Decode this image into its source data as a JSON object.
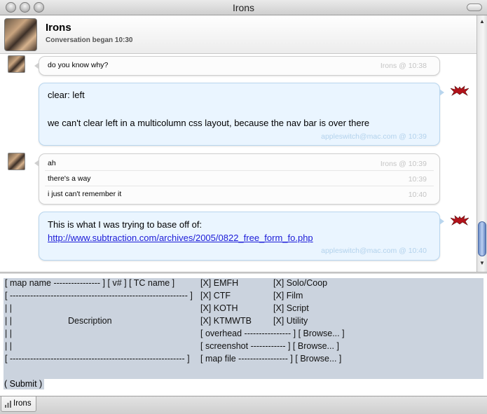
{
  "window": {
    "title": "Irons"
  },
  "header": {
    "name": "Irons",
    "subtitle": "Conversation began 10:30"
  },
  "messages": [
    {
      "lines": [
        {
          "text": "do you know why?",
          "stamp": "Irons @ 10:38"
        }
      ]
    },
    {
      "lines": [
        {
          "text": "clear: left"
        },
        {
          "text": "we can't clear left in a multicolumn css layout, because the nav bar is over there"
        }
      ],
      "stamp": "appleswitch@mac.com @ 10:39"
    },
    {
      "lines": [
        {
          "text": "ah",
          "stamp": "Irons @ 10:39"
        },
        {
          "text": "there's a way",
          "stamp": "10:39"
        },
        {
          "text": "i just can't remember it",
          "stamp": "10:40"
        }
      ]
    },
    {
      "lines": [
        {
          "text": "This is what I was trying to base off of:"
        },
        {
          "text": "http://www.subtraction.com/archives/2005/0822_free_form_fo.php"
        }
      ],
      "stamp": "appleswitch@mac.com @ 10:40"
    }
  ],
  "form": {
    "left_lines": [
      "[ map name ---------------- ] [ v# ] [ TC name ]",
      "[ -------------------------------------------------------------    ]",
      "|                                                                    |",
      "|                                                                    |",
      "|                                                                    |",
      "|                                                                    |",
      "[ ------------------------------------------------------------     ]"
    ],
    "description_label": "Description",
    "col2": [
      "[X] EMFH",
      "[X] CTF",
      "[X] KOTH",
      "[X] KTMWTB",
      "[ overhead ---------------- ] [ Browse... ]",
      "[ screenshot ------------ ] [ Browse... ]",
      "[ map file ----------------- ] [ Browse... ]"
    ],
    "col3": [
      "[X] Solo/Coop",
      "[X] Film",
      "[X] Script",
      "[X] Utility"
    ],
    "submit_label": "( Submit )"
  },
  "tabs": [
    {
      "label": "Irons",
      "icon": "signal-bars-icon"
    }
  ],
  "colors": {
    "own_bubble": "#eaf5ff",
    "other_bubble": "#fcfcfc",
    "link": "#1b1bd8",
    "form_background": "#cbd3de"
  }
}
